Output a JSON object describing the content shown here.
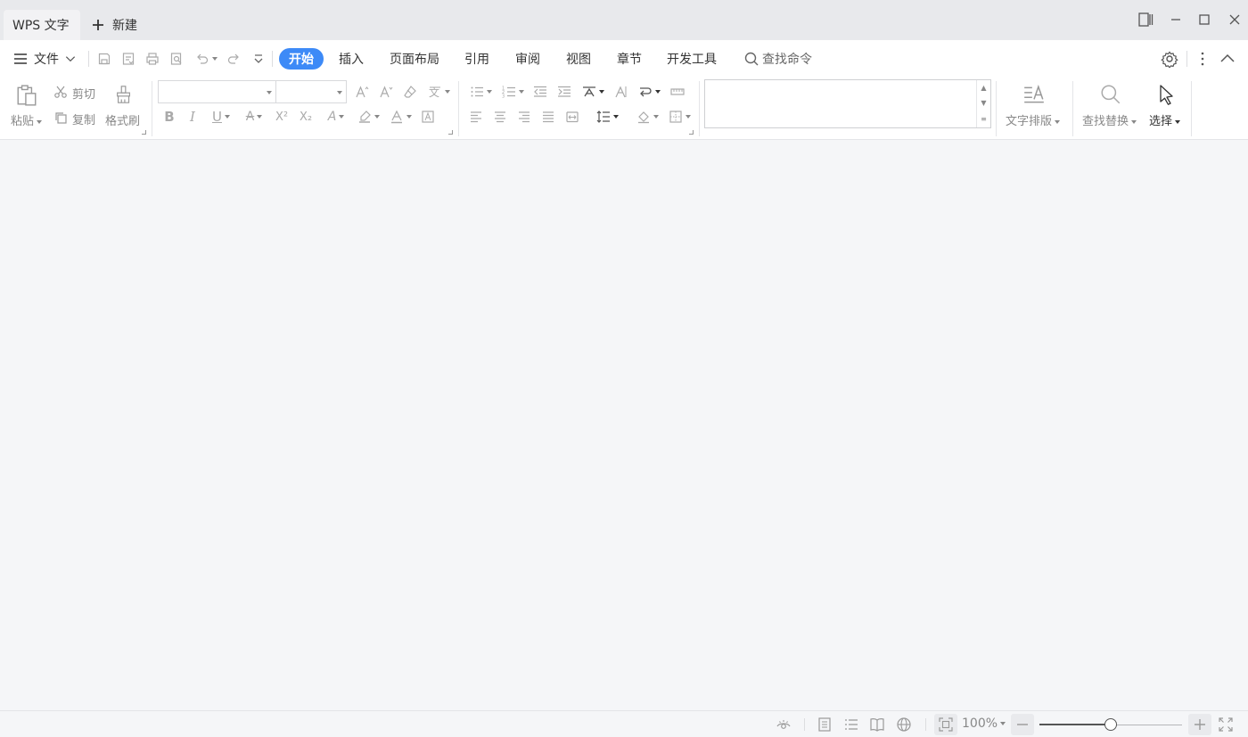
{
  "titlebar": {
    "active_tab": "WPS 文字",
    "new_tab": "新建"
  },
  "menubar": {
    "file_label": "文件",
    "tabs": [
      {
        "label": "开始",
        "active": true
      },
      {
        "label": "插入",
        "active": false
      },
      {
        "label": "页面布局",
        "active": false
      },
      {
        "label": "引用",
        "active": false
      },
      {
        "label": "审阅",
        "active": false
      },
      {
        "label": "视图",
        "active": false
      },
      {
        "label": "章节",
        "active": false
      },
      {
        "label": "开发工具",
        "active": false
      }
    ],
    "search_placeholder": "查找命令"
  },
  "ribbon": {
    "clipboard": {
      "paste": "粘贴",
      "cut": "剪切",
      "copy": "复制",
      "format_painter": "格式刷"
    },
    "font_name": "",
    "font_size": "",
    "text_layout": "文字排版",
    "find_replace": "查找替换",
    "select": "选择"
  },
  "statusbar": {
    "zoom_level": "100%",
    "zoom_fraction": 0.5
  },
  "colors": {
    "accent": "#3d8af7",
    "titlebar_bg": "#e8e9ec",
    "doc_bg": "#f5f6f8"
  }
}
